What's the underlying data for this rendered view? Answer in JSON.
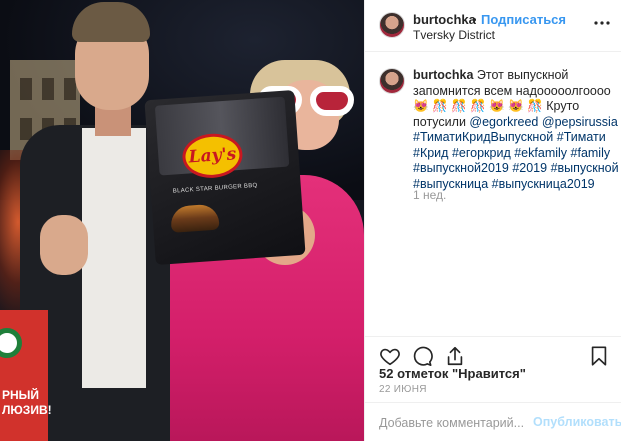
{
  "post": {
    "header": {
      "username": "burtochka",
      "separator": "•",
      "follow_label": "Подписаться",
      "location": "Tversky District",
      "more_icon": "more-horizontal-icon"
    },
    "photo": {
      "pack_brand": "Lay's",
      "pack_flavor": "BLACK STAR BURGER BBQ",
      "banner_text": "РНЫЙ\nЛЮЗИВ!"
    },
    "caption": {
      "username": "burtochka",
      "text_before": " Этот выпускной запомнится всем надооооолгоооо ",
      "emoji_1": "😻 🎊 🎊 🎊 😻 😻 🎊",
      "text_after": " Круто потусили ",
      "mentions": [
        "@egorkreed",
        "@pepsirussia"
      ],
      "hashtags": [
        "#ТиматиКридВыпускной",
        "#Тимати",
        "#Крид",
        "#егоркрид",
        "#ekfamily",
        "#family",
        "#выпускной2019",
        "#2019",
        "#выпускной",
        "#выпускница",
        "#выпускница2019"
      ],
      "time_ago": "1 нед."
    },
    "actions": {
      "like_icon": "heart-icon",
      "comment_icon": "comment-icon",
      "share_icon": "share-icon",
      "save_icon": "bookmark-icon"
    },
    "likes_text": "52 отметок \"Нравится\"",
    "date": "22 ИЮНЯ",
    "comment": {
      "placeholder": "Добавьте комментарий...",
      "publish_label": "Опубликовать"
    },
    "colors": {
      "link_blue": "#3897f0",
      "hashtag_blue": "#003569",
      "publish_disabled": "#b2dffc",
      "muted_gray": "#999999",
      "dress_pink": "#e4307a"
    }
  }
}
